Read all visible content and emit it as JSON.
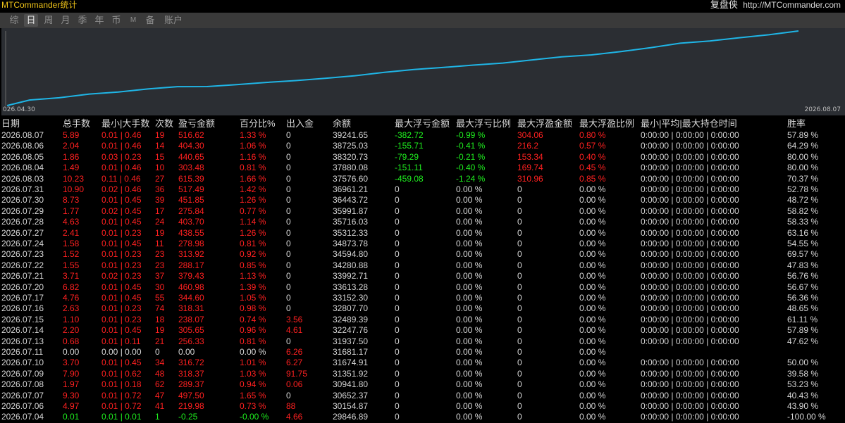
{
  "app": {
    "title": "MTCommander统计",
    "brand_name": "复盘侠",
    "brand_url": "http://MTCommander.com"
  },
  "tabs": [
    {
      "label": "综",
      "active": false
    },
    {
      "label": "日",
      "active": true
    },
    {
      "label": "周",
      "active": false
    },
    {
      "label": "月",
      "active": false
    },
    {
      "label": "季",
      "active": false
    },
    {
      "label": "年",
      "active": false
    },
    {
      "label": "币",
      "active": false
    },
    {
      "label": "M",
      "active": false
    },
    {
      "label": "备",
      "active": false
    },
    {
      "label": "账户",
      "active": false
    }
  ],
  "chart_data": {
    "type": "line",
    "x_start_label": "026.04.30",
    "x_end_label": "2026.08.07",
    "x": [
      "2026.07.04",
      "2026.07.06",
      "2026.07.07",
      "2026.07.08",
      "2026.07.09",
      "2026.07.10",
      "2026.07.11",
      "2026.07.13",
      "2026.07.14",
      "2026.07.15",
      "2026.07.16",
      "2026.07.17",
      "2026.07.20",
      "2026.07.21",
      "2026.07.22",
      "2026.07.23",
      "2026.07.24",
      "2026.07.27",
      "2026.07.28",
      "2026.07.29",
      "2026.07.30",
      "2026.07.31",
      "2026.08.03",
      "2026.08.04",
      "2026.08.05",
      "2026.08.06",
      "2026.08.07"
    ],
    "series": [
      {
        "values": [
          29846.89,
          30154.87,
          30652.37,
          30941.8,
          31351.92,
          31674.91,
          31681.17,
          31937.5,
          32247.76,
          32489.39,
          32807.7,
          33152.3,
          33613.28,
          33992.71,
          34280.88,
          34594.8,
          34873.78,
          35312.33,
          35716.03,
          35991.87,
          36443.72,
          36961.21,
          37576.6,
          37880.08,
          38320.73,
          38725.03,
          39241.65
        ]
      }
    ],
    "line_color": "#1fb5e6",
    "background": "#2b2e33"
  },
  "table": {
    "columns": [
      "日期",
      "总手数",
      "最小|大手数",
      "次数",
      "盈亏金额",
      "百分比%",
      "出入金",
      "余额",
      "最大浮亏金额",
      "最大浮亏比例",
      "最大浮盈金额",
      "最大浮盈比例",
      "最小|平均|最大持仓时间",
      "胜率"
    ],
    "rows": [
      {
        "c": [
          "2026.08.07",
          "5.89",
          "0.01 | 0.46",
          "19",
          "516.62",
          "1.33 %",
          "0",
          "39241.65",
          "-382.72",
          "-0.99 %",
          "304.06",
          "0.80 %",
          "0:00:00 | 0:00:00 | 0:00:00",
          "57.89 %"
        ],
        "k": [
          "w",
          "r",
          "r",
          "r",
          "r",
          "r",
          "w",
          "w",
          "g",
          "g",
          "r",
          "r",
          "w",
          "w"
        ]
      },
      {
        "c": [
          "2026.08.06",
          "2.04",
          "0.01 | 0.46",
          "14",
          "404.30",
          "1.06 %",
          "0",
          "38725.03",
          "-155.71",
          "-0.41 %",
          "216.2",
          "0.57 %",
          "0:00:00 | 0:00:00 | 0:00:00",
          "64.29 %"
        ],
        "k": [
          "w",
          "r",
          "r",
          "r",
          "r",
          "r",
          "w",
          "w",
          "g",
          "g",
          "r",
          "r",
          "w",
          "w"
        ]
      },
      {
        "c": [
          "2026.08.05",
          "1.86",
          "0.03 | 0.23",
          "15",
          "440.65",
          "1.16 %",
          "0",
          "38320.73",
          "-79.29",
          "-0.21 %",
          "153.34",
          "0.40 %",
          "0:00:00 | 0:00:00 | 0:00:00",
          "80.00 %"
        ],
        "k": [
          "w",
          "r",
          "r",
          "r",
          "r",
          "r",
          "w",
          "w",
          "g",
          "g",
          "r",
          "r",
          "w",
          "w"
        ]
      },
      {
        "c": [
          "2026.08.04",
          "1.49",
          "0.01 | 0.46",
          "10",
          "303.48",
          "0.81 %",
          "0",
          "37880.08",
          "-151.11",
          "-0.40 %",
          "169.74",
          "0.45 %",
          "0:00:00 | 0:00:00 | 0:00:00",
          "80.00 %"
        ],
        "k": [
          "w",
          "r",
          "r",
          "r",
          "r",
          "r",
          "w",
          "w",
          "g",
          "g",
          "r",
          "r",
          "w",
          "w"
        ]
      },
      {
        "c": [
          "2026.08.03",
          "10.23",
          "0.11 | 0.46",
          "27",
          "615.39",
          "1.66 %",
          "0",
          "37576.60",
          "-459.08",
          "-1.24 %",
          "310.96",
          "0.85 %",
          "0:00:00 | 0:00:00 | 0:00:00",
          "70.37 %"
        ],
        "k": [
          "w",
          "r",
          "r",
          "r",
          "r",
          "r",
          "w",
          "w",
          "g",
          "g",
          "r",
          "r",
          "w",
          "w"
        ]
      },
      {
        "c": [
          "2026.07.31",
          "10.90",
          "0.02 | 0.46",
          "36",
          "517.49",
          "1.42 %",
          "0",
          "36961.21",
          "0",
          "0.00 %",
          "0",
          "0.00 %",
          "0:00:00 | 0:00:00 | 0:00:00",
          "52.78 %"
        ],
        "k": [
          "w",
          "r",
          "r",
          "r",
          "r",
          "r",
          "w",
          "w",
          "w",
          "w",
          "w",
          "w",
          "w",
          "w"
        ]
      },
      {
        "c": [
          "2026.07.30",
          "8.73",
          "0.01 | 0.45",
          "39",
          "451.85",
          "1.26 %",
          "0",
          "36443.72",
          "0",
          "0.00 %",
          "0",
          "0.00 %",
          "0:00:00 | 0:00:00 | 0:00:00",
          "48.72 %"
        ],
        "k": [
          "w",
          "r",
          "r",
          "r",
          "r",
          "r",
          "w",
          "w",
          "w",
          "w",
          "w",
          "w",
          "w",
          "w"
        ]
      },
      {
        "c": [
          "2026.07.29",
          "1.77",
          "0.02 | 0.45",
          "17",
          "275.84",
          "0.77 %",
          "0",
          "35991.87",
          "0",
          "0.00 %",
          "0",
          "0.00 %",
          "0:00:00 | 0:00:00 | 0:00:00",
          "58.82 %"
        ],
        "k": [
          "w",
          "r",
          "r",
          "r",
          "r",
          "r",
          "w",
          "w",
          "w",
          "w",
          "w",
          "w",
          "w",
          "w"
        ]
      },
      {
        "c": [
          "2026.07.28",
          "4.63",
          "0.01 | 0.45",
          "24",
          "403.70",
          "1.14 %",
          "0",
          "35716.03",
          "0",
          "0.00 %",
          "0",
          "0.00 %",
          "0:00:00 | 0:00:00 | 0:00:00",
          "58.33 %"
        ],
        "k": [
          "w",
          "r",
          "r",
          "r",
          "r",
          "r",
          "w",
          "w",
          "w",
          "w",
          "w",
          "w",
          "w",
          "w"
        ]
      },
      {
        "c": [
          "2026.07.27",
          "2.41",
          "0.01 | 0.23",
          "19",
          "438.55",
          "1.26 %",
          "0",
          "35312.33",
          "0",
          "0.00 %",
          "0",
          "0.00 %",
          "0:00:00 | 0:00:00 | 0:00:00",
          "63.16 %"
        ],
        "k": [
          "w",
          "r",
          "r",
          "r",
          "r",
          "r",
          "w",
          "w",
          "w",
          "w",
          "w",
          "w",
          "w",
          "w"
        ]
      },
      {
        "c": [
          "2026.07.24",
          "1.58",
          "0.01 | 0.45",
          "11",
          "278.98",
          "0.81 %",
          "0",
          "34873.78",
          "0",
          "0.00 %",
          "0",
          "0.00 %",
          "0:00:00 | 0:00:00 | 0:00:00",
          "54.55 %"
        ],
        "k": [
          "w",
          "r",
          "r",
          "r",
          "r",
          "r",
          "w",
          "w",
          "w",
          "w",
          "w",
          "w",
          "w",
          "w"
        ]
      },
      {
        "c": [
          "2026.07.23",
          "1.52",
          "0.01 | 0.23",
          "23",
          "313.92",
          "0.92 %",
          "0",
          "34594.80",
          "0",
          "0.00 %",
          "0",
          "0.00 %",
          "0:00:00 | 0:00:00 | 0:00:00",
          "69.57 %"
        ],
        "k": [
          "w",
          "r",
          "r",
          "r",
          "r",
          "r",
          "w",
          "w",
          "w",
          "w",
          "w",
          "w",
          "w",
          "w"
        ]
      },
      {
        "c": [
          "2026.07.22",
          "1.55",
          "0.01 | 0.23",
          "23",
          "288.17",
          "0.85 %",
          "0",
          "34280.88",
          "0",
          "0.00 %",
          "0",
          "0.00 %",
          "0:00:00 | 0:00:00 | 0:00:00",
          "47.83 %"
        ],
        "k": [
          "w",
          "r",
          "r",
          "r",
          "r",
          "r",
          "w",
          "w",
          "w",
          "w",
          "w",
          "w",
          "w",
          "w"
        ]
      },
      {
        "c": [
          "2026.07.21",
          "3.71",
          "0.02 | 0.23",
          "37",
          "379.43",
          "1.13 %",
          "0",
          "33992.71",
          "0",
          "0.00 %",
          "0",
          "0.00 %",
          "0:00:00 | 0:00:00 | 0:00:00",
          "56.76 %"
        ],
        "k": [
          "w",
          "r",
          "r",
          "r",
          "r",
          "r",
          "w",
          "w",
          "w",
          "w",
          "w",
          "w",
          "w",
          "w"
        ]
      },
      {
        "c": [
          "2026.07.20",
          "6.82",
          "0.01 | 0.45",
          "30",
          "460.98",
          "1.39 %",
          "0",
          "33613.28",
          "0",
          "0.00 %",
          "0",
          "0.00 %",
          "0:00:00 | 0:00:00 | 0:00:00",
          "56.67 %"
        ],
        "k": [
          "w",
          "r",
          "r",
          "r",
          "r",
          "r",
          "w",
          "w",
          "w",
          "w",
          "w",
          "w",
          "w",
          "w"
        ]
      },
      {
        "c": [
          "2026.07.17",
          "4.76",
          "0.01 | 0.45",
          "55",
          "344.60",
          "1.05 %",
          "0",
          "33152.30",
          "0",
          "0.00 %",
          "0",
          "0.00 %",
          "0:00:00 | 0:00:00 | 0:00:00",
          "56.36 %"
        ],
        "k": [
          "w",
          "r",
          "r",
          "r",
          "r",
          "r",
          "w",
          "w",
          "w",
          "w",
          "w",
          "w",
          "w",
          "w"
        ]
      },
      {
        "c": [
          "2026.07.16",
          "2.63",
          "0.01 | 0.23",
          "74",
          "318.31",
          "0.98 %",
          "0",
          "32807.70",
          "0",
          "0.00 %",
          "0",
          "0.00 %",
          "0:00:00 | 0:00:00 | 0:00:00",
          "48.65 %"
        ],
        "k": [
          "w",
          "r",
          "r",
          "r",
          "r",
          "r",
          "w",
          "w",
          "w",
          "w",
          "w",
          "w",
          "w",
          "w"
        ]
      },
      {
        "c": [
          "2026.07.15",
          "1.10",
          "0.01 | 0.23",
          "18",
          "238.07",
          "0.74 %",
          "3.56",
          "32489.39",
          "0",
          "0.00 %",
          "0",
          "0.00 %",
          "0:00:00 | 0:00:00 | 0:00:00",
          "61.11 %"
        ],
        "k": [
          "w",
          "r",
          "r",
          "r",
          "r",
          "r",
          "r",
          "w",
          "w",
          "w",
          "w",
          "w",
          "w",
          "w"
        ]
      },
      {
        "c": [
          "2026.07.14",
          "2.20",
          "0.01 | 0.45",
          "19",
          "305.65",
          "0.96 %",
          "4.61",
          "32247.76",
          "0",
          "0.00 %",
          "0",
          "0.00 %",
          "0:00:00 | 0:00:00 | 0:00:00",
          "57.89 %"
        ],
        "k": [
          "w",
          "r",
          "r",
          "r",
          "r",
          "r",
          "r",
          "w",
          "w",
          "w",
          "w",
          "w",
          "w",
          "w"
        ]
      },
      {
        "c": [
          "2026.07.13",
          "0.68",
          "0.01 | 0.11",
          "21",
          "256.33",
          "0.81 %",
          "0",
          "31937.50",
          "0",
          "0.00 %",
          "0",
          "0.00 %",
          "0:00:00 | 0:00:00 | 0:00:00",
          "47.62 %"
        ],
        "k": [
          "w",
          "r",
          "r",
          "r",
          "r",
          "r",
          "w",
          "w",
          "w",
          "w",
          "w",
          "w",
          "w",
          "w"
        ]
      },
      {
        "c": [
          "2026.07.11",
          "0.00",
          "0.00 | 0.00",
          "0",
          "0.00",
          "0.00 %",
          "6.26",
          "31681.17",
          "0",
          "0.00 %",
          "0",
          "0.00 %",
          "",
          ""
        ],
        "k": [
          "w",
          "w",
          "w",
          "w",
          "w",
          "w",
          "r",
          "w",
          "w",
          "w",
          "w",
          "w",
          "w",
          "w"
        ]
      },
      {
        "c": [
          "2026.07.10",
          "3.70",
          "0.01 | 0.45",
          "34",
          "316.72",
          "1.01 %",
          "6.27",
          "31674.91",
          "0",
          "0.00 %",
          "0",
          "0.00 %",
          "0:00:00 | 0:00:00 | 0:00:00",
          "50.00 %"
        ],
        "k": [
          "w",
          "r",
          "r",
          "r",
          "r",
          "r",
          "r",
          "w",
          "w",
          "w",
          "w",
          "w",
          "w",
          "w"
        ]
      },
      {
        "c": [
          "2026.07.09",
          "7.90",
          "0.01 | 0.62",
          "48",
          "318.37",
          "1.03 %",
          "91.75",
          "31351.92",
          "0",
          "0.00 %",
          "0",
          "0.00 %",
          "0:00:00 | 0:00:00 | 0:00:00",
          "39.58 %"
        ],
        "k": [
          "w",
          "r",
          "r",
          "r",
          "r",
          "r",
          "r",
          "w",
          "w",
          "w",
          "w",
          "w",
          "w",
          "w"
        ]
      },
      {
        "c": [
          "2026.07.08",
          "1.97",
          "0.01 | 0.18",
          "62",
          "289.37",
          "0.94 %",
          "0.06",
          "30941.80",
          "0",
          "0.00 %",
          "0",
          "0.00 %",
          "0:00:00 | 0:00:00 | 0:00:00",
          "53.23 %"
        ],
        "k": [
          "w",
          "r",
          "r",
          "r",
          "r",
          "r",
          "r",
          "w",
          "w",
          "w",
          "w",
          "w",
          "w",
          "w"
        ]
      },
      {
        "c": [
          "2026.07.07",
          "9.30",
          "0.01 | 0.72",
          "47",
          "497.50",
          "1.65 %",
          "0",
          "30652.37",
          "0",
          "0.00 %",
          "0",
          "0.00 %",
          "0:00:00 | 0:00:00 | 0:00:00",
          "40.43 %"
        ],
        "k": [
          "w",
          "r",
          "r",
          "r",
          "r",
          "r",
          "w",
          "w",
          "w",
          "w",
          "w",
          "w",
          "w",
          "w"
        ]
      },
      {
        "c": [
          "2026.07.06",
          "4.97",
          "0.01 | 0.72",
          "41",
          "219.98",
          "0.73 %",
          "88",
          "30154.87",
          "0",
          "0.00 %",
          "0",
          "0.00 %",
          "0:00:00 | 0:00:00 | 0:00:00",
          "43.90 %"
        ],
        "k": [
          "w",
          "r",
          "r",
          "r",
          "r",
          "r",
          "r",
          "w",
          "w",
          "w",
          "w",
          "w",
          "w",
          "w"
        ]
      },
      {
        "c": [
          "2026.07.04",
          "0.01",
          "0.01 | 0.01",
          "1",
          "-0.25",
          "-0.00 %",
          "4.66",
          "29846.89",
          "0",
          "0.00 %",
          "0",
          "0.00 %",
          "0:00:00 | 0:00:00 | 0:00:00",
          "-100.00 %"
        ],
        "k": [
          "w",
          "g",
          "g",
          "g",
          "g",
          "g",
          "r",
          "w",
          "w",
          "w",
          "w",
          "w",
          "w",
          "w"
        ]
      }
    ]
  },
  "colors": {
    "background": "#000000",
    "tab_bar": "#3a3a3a",
    "chart_bg": "#2b2e33",
    "line": "#1fb5e6",
    "positive": "#ff2020",
    "negative": "#1ef01e",
    "neutral": "#d6d6d6",
    "title": "#f0c419"
  }
}
